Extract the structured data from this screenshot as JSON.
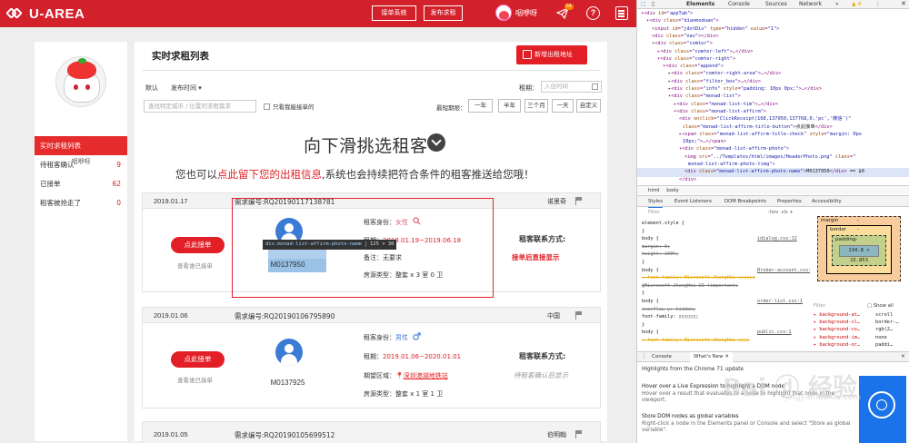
{
  "site": {
    "brand": "U-AREA",
    "top_buttons": [
      "接单系统",
      "发布求租"
    ],
    "user_name": "咽咿呀",
    "msg_count": "54",
    "help_icon": "?",
    "sidebar": {
      "profile_name": "咽咿呀",
      "items": [
        {
          "label": "实时求租列表",
          "count": ""
        },
        {
          "label": "待租客确认",
          "count": "9"
        },
        {
          "label": "已接单",
          "count": "62"
        },
        {
          "label": "租客被抢走了",
          "count": "0"
        }
      ]
    },
    "main": {
      "title": "实时求租列表",
      "new_button": "新增出租地址",
      "sort_default": "默认",
      "sort_time": "发布时间 ▾",
      "rent_label": "租期：",
      "rent_placeholder": "入住时间",
      "city_placeholder": "查找特定城市 / 位置的求租需求",
      "only_mine": "只看我能接单的",
      "period_label": "最短期限：",
      "periods": [
        "一年",
        "半年",
        "三个月",
        "一天",
        "自定义"
      ],
      "swipe_title": "向下滑挑选租客",
      "promo_pre": "您也可以",
      "promo_em": "点此留下您的出租信息",
      "promo_post": ",系统也会持续把符合条件的租客推送给您哦！"
    },
    "cards": [
      {
        "date": "2019.01.17",
        "no": "需求编号:RQ20190117138781",
        "place": "诺里奇",
        "take": "点此接单",
        "view": "查看谁已接单",
        "photo_name": "M0137950",
        "identity_label": "租客身份：",
        "identity": "女性",
        "period_label": "租期：",
        "period": "2019.01.19~2019.06.18",
        "note_label": "备注：",
        "note": "无要求",
        "type_label": "房源类型：",
        "type": "整套 x 3 室 0 卫",
        "contact_h": "租客联系方式:",
        "contact_v": "接单后直接显示"
      },
      {
        "date": "2019.01.06",
        "no": "需求编号:RQ20190106795890",
        "place": "中国",
        "take": "点此接单",
        "view": "查看谁已接单",
        "photo_name": "M0137925",
        "identity_label": "租客身份：",
        "identity": "男性",
        "period_label": "租期：",
        "period": "2019.01.06~2020.01.01",
        "area_label": "期望区域：",
        "area": "深圳港湖地铁站",
        "type_label": "房源类型：",
        "type": "整套 x 1 室 1 卫",
        "contact_h": "租客联系方式:",
        "contact_v": "待租客确认后显示"
      },
      {
        "date": "2019.01.05",
        "no": "需求编号:RQ20190105699512",
        "place": "伯明翰"
      }
    ],
    "tooltip": {
      "selector": "div.monad-list-affirm-photo-name",
      "size": "125 × 30"
    }
  },
  "devtools": {
    "tabs": [
      "Elements",
      "Console",
      "Sources",
      "Network",
      "»"
    ],
    "warn_count": "▲ 4",
    "dom_lines": [
      {
        "ind": 4,
        "html": "<span class='tg'>▾&lt;div</span> <span class='at'>id</span>=<span class='av'>\"appTab\"</span><span class='tg'>&gt;</span>"
      },
      {
        "ind": 10,
        "html": "<span class='tg'>▾&lt;div</span> <span class='at'>class</span>=<span class='av'>\"dianmoduan\"</span><span class='tg'>&gt;</span>"
      },
      {
        "ind": 16,
        "html": "<span class='tg'>&lt;input</span> <span class='at'>id</span>=<span class='av'>\"jdxtDiv\"</span> <span class='at'>type</span>=<span class='av'>\"hidden\"</span> <span class='at'>value</span>=<span class='av'>\"1\"</span><span class='tg'>&gt;</span>"
      },
      {
        "ind": 16,
        "html": "<span class='tg'>&lt;div</span> <span class='at'>class</span>=<span class='av'>\"nav\"</span><span class='tg'>&gt;&lt;/div&gt;</span>"
      },
      {
        "ind": 16,
        "html": "<span class='tg'>▾&lt;div</span> <span class='at'>class</span>=<span class='av'>\"comter\"</span><span class='tg'>&gt;</span>"
      },
      {
        "ind": 22,
        "html": "<span class='tg'>▸&lt;div</span> <span class='at'>class</span>=<span class='av'>\"comter-left\"</span><span class='tg'>&gt;</span>…<span class='tg'>&lt;/div&gt;</span>"
      },
      {
        "ind": 22,
        "html": "<span class='tg'>▾&lt;div</span> <span class='at'>class</span>=<span class='av'>\"comter-right\"</span><span class='tg'>&gt;</span>"
      },
      {
        "ind": 28,
        "html": "<span class='tg'>▾&lt;div</span> <span class='at'>class</span>=<span class='av'>\"append\"</span><span class='tg'>&gt;</span>"
      },
      {
        "ind": 34,
        "html": "<span class='tg'>▸&lt;div</span> <span class='at'>class</span>=<span class='av'>\"comter-right-area\"</span><span class='tg'>&gt;</span>…<span class='tg'>&lt;/div&gt;</span>"
      },
      {
        "ind": 34,
        "html": "<span class='tg'>▸&lt;div</span> <span class='at'>class</span>=<span class='av'>\"filter_box\"</span><span class='tg'>&gt;</span>…<span class='tg'>&lt;/div&gt;</span>"
      },
      {
        "ind": 34,
        "html": "<span class='tg'>▸&lt;div</span> <span class='at'>class</span>=<span class='av'>\"info\"</span> <span class='at'>style</span>=<span class='av'>\"padding: 10px 0px;\"</span><span class='tg'>&gt;</span>…<span class='tg'>&lt;/div&gt;</span>"
      },
      {
        "ind": 34,
        "html": "<span class='tg'>▾&lt;div</span> <span class='at'>class</span>=<span class='av'>\"monad-list\"</span><span class='tg'>&gt;</span>"
      },
      {
        "ind": 40,
        "html": "<span class='tg'>▸&lt;div</span> <span class='at'>class</span>=<span class='av'>\"monad-list-tim\"</span><span class='tg'>&gt;</span>…<span class='tg'>&lt;/div&gt;</span>"
      },
      {
        "ind": 40,
        "html": "<span class='tg'>▾&lt;div</span> <span class='at'>class</span>=<span class='av'>\"monad-list-affirm\"</span><span class='tg'>&gt;</span>"
      },
      {
        "ind": 46,
        "html": "<span class='tg'>&lt;div</span> <span class='at'>onclick</span>=<span class='av'>\"ClickReceipt(168,137950,137768,0,'pc','微信')\"</span>"
      },
      {
        "ind": 50,
        "html": "<span class='at'>class</span>=<span class='av'>\"monad-list-affirm-title-button\"</span><span class='tg'>&gt;</span><span class='tx'>点此接单</span><span class='tg'>&lt;/div&gt;</span>"
      },
      {
        "ind": 46,
        "html": "<span class='tg'>▸&lt;span</span> <span class='at'>class</span>=<span class='av'>\"monad-list-affirm-title-check\"</span> <span class='at'>style</span>=<span class='av'>\"margin: 0px</span>"
      },
      {
        "ind": 50,
        "html": "<span class='av'>10px;\"</span><span class='tg'>&gt;</span>…<span class='tg'>&lt;/span&gt;</span>"
      },
      {
        "ind": 46,
        "html": "<span class='tg'>▾&lt;div</span> <span class='at'>class</span>=<span class='av'>\"monad-list-affirm-photo\"</span><span class='tg'>&gt;</span>"
      },
      {
        "ind": 52,
        "html": "<span class='tg'>&lt;img</span> <span class='at'>src</span>=<span class='av'>\"../Templates/html/images/HeaderPhoto.png\"</span> <span class='at'>class</span>=<span class='av'>\"</span>"
      },
      {
        "ind": 56,
        "html": "<span class='av'>monad-list-affirm-photo-timg\"</span><span class='tg'>&gt;</span>"
      },
      {
        "ind": 52,
        "html": "<span class='tg'>&lt;div</span> <span class='at'>class</span>=<span class='av'>\"monad-list-affirm-photo-name\"</span><span class='tg'>&gt;</span><span class='tx'>M0137950</span><span class='tg'>&lt;/div&gt;</span>",
        "selected": true
      },
      {
        "ind": 46,
        "html": "<span class='tg'>&lt;/div&gt;</span>"
      }
    ],
    "crumbs": [
      "html",
      "body"
    ],
    "subtabs": [
      "Styles",
      "Event Listeners",
      "DOM Breakpoints",
      "Properties",
      "Accessibility"
    ],
    "styles": {
      "filter": "Filter",
      "hov": ":hov  .cls  +",
      "lines": [
        {
          "t": "element.style {",
          "c": ""
        },
        {
          "t": "}",
          "c": ""
        },
        {
          "t": "body {",
          "c": "",
          "src": "idialog.css:12"
        },
        {
          "t": "  margin: 0;",
          "c": "strike"
        },
        {
          "t": "  height: 100%;",
          "c": "strike"
        },
        {
          "t": "}",
          "c": ""
        },
        {
          "t": "body {",
          "c": "",
          "src": "Broker-account.css:1"
        },
        {
          "t": "⚠ font-family: Microsoft JhengHei ▯▯▯▯▯▯",
          "c": "strike warn"
        },
        {
          "t": "    @Microsoft JhengHei UI !important;",
          "c": "strike"
        },
        {
          "t": "}",
          "c": ""
        },
        {
          "t": "body {",
          "c": "",
          "src": "order-list.css:1"
        },
        {
          "t": "  overflow-y: hidden;",
          "c": "strike"
        },
        {
          "t": "  font-family: ▯▯▯▯▯▯;",
          "c": ""
        },
        {
          "t": "}",
          "c": ""
        },
        {
          "t": "body {",
          "c": "",
          "src": "public.css:1"
        },
        {
          "t": "⚠ font-family: Microsoft JhengHei ▯▯▯▯",
          "c": "strike warn"
        }
      ]
    },
    "box_model": {
      "margin": "margin",
      "margin_val": "-",
      "border": "border",
      "border_val": "-",
      "padding": "padding-",
      "content": "134.8 × 15.853"
    },
    "computed": {
      "filter": "Filter",
      "show_all": "□ Show all",
      "props": [
        {
          "k": "▸ background-at…",
          "v": "scroll"
        },
        {
          "k": "▸ background-cl…",
          "v": "border-…"
        },
        {
          "k": "▸ background-co…",
          "v": "rgb(2…"
        },
        {
          "k": "▸ background-im…",
          "v": "none"
        },
        {
          "k": "▸ background-or…",
          "v": "paddi…"
        }
      ]
    },
    "drawer": {
      "tabs": [
        "Console",
        "What's New"
      ],
      "title": "Highlights from the Chrome 71 update",
      "items": [
        {
          "h": "Hover over a Live Expression to highlight a DOM node",
          "s": "Hover over a result that evaluates to a node to highlight that node in the viewport."
        },
        {
          "h": "Store DOM nodes as global variables",
          "s": "Right-click a node in the Elements panel or Console and select \"Store as global variable\"."
        }
      ]
    }
  },
  "watermark": {
    "text": "Bai ⓓ 经验",
    "sub": "jingyan.baidu.com"
  }
}
